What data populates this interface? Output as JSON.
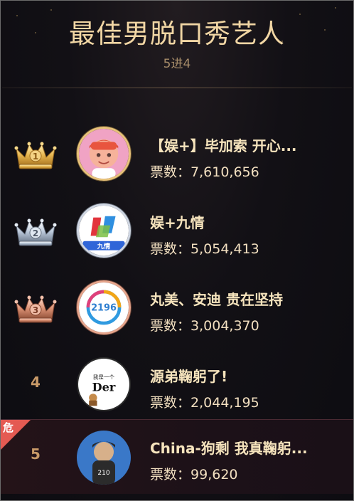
{
  "header": {
    "title": "最佳男脱口秀艺人",
    "subtitle": "5进4"
  },
  "colors": {
    "gold": "#e7c27a",
    "silver": "#cfd6e2",
    "bronze": "#e6a58c",
    "danger": "#e45a52"
  },
  "danger_label": "危",
  "entries": [
    {
      "rank": "1",
      "badge": "gold-crown-icon",
      "name": "【娱+】毕加索 开心...",
      "votes_label": "票数：",
      "votes": "7,610,656"
    },
    {
      "rank": "2",
      "badge": "silver-crown-icon",
      "name": "娱+九情",
      "votes_label": "票数：",
      "votes": "5,054,413"
    },
    {
      "rank": "3",
      "badge": "bronze-crown-icon",
      "name": "丸美、安迪 贵在坚持",
      "votes_label": "票数：",
      "votes": "3,004,370"
    },
    {
      "rank": "4",
      "name": "源弟鞠躬了!",
      "votes_label": "票数：",
      "votes": "2,044,195"
    },
    {
      "rank": "5",
      "name": "China-狗剩 我真鞠躬...",
      "votes_label": "票数：",
      "votes": "99,620"
    }
  ],
  "avatars": {
    "avatar2_text": "九情",
    "avatar3_text": "2196",
    "avatar4_text_small": "我是一个",
    "avatar4_text_big": "Der"
  }
}
